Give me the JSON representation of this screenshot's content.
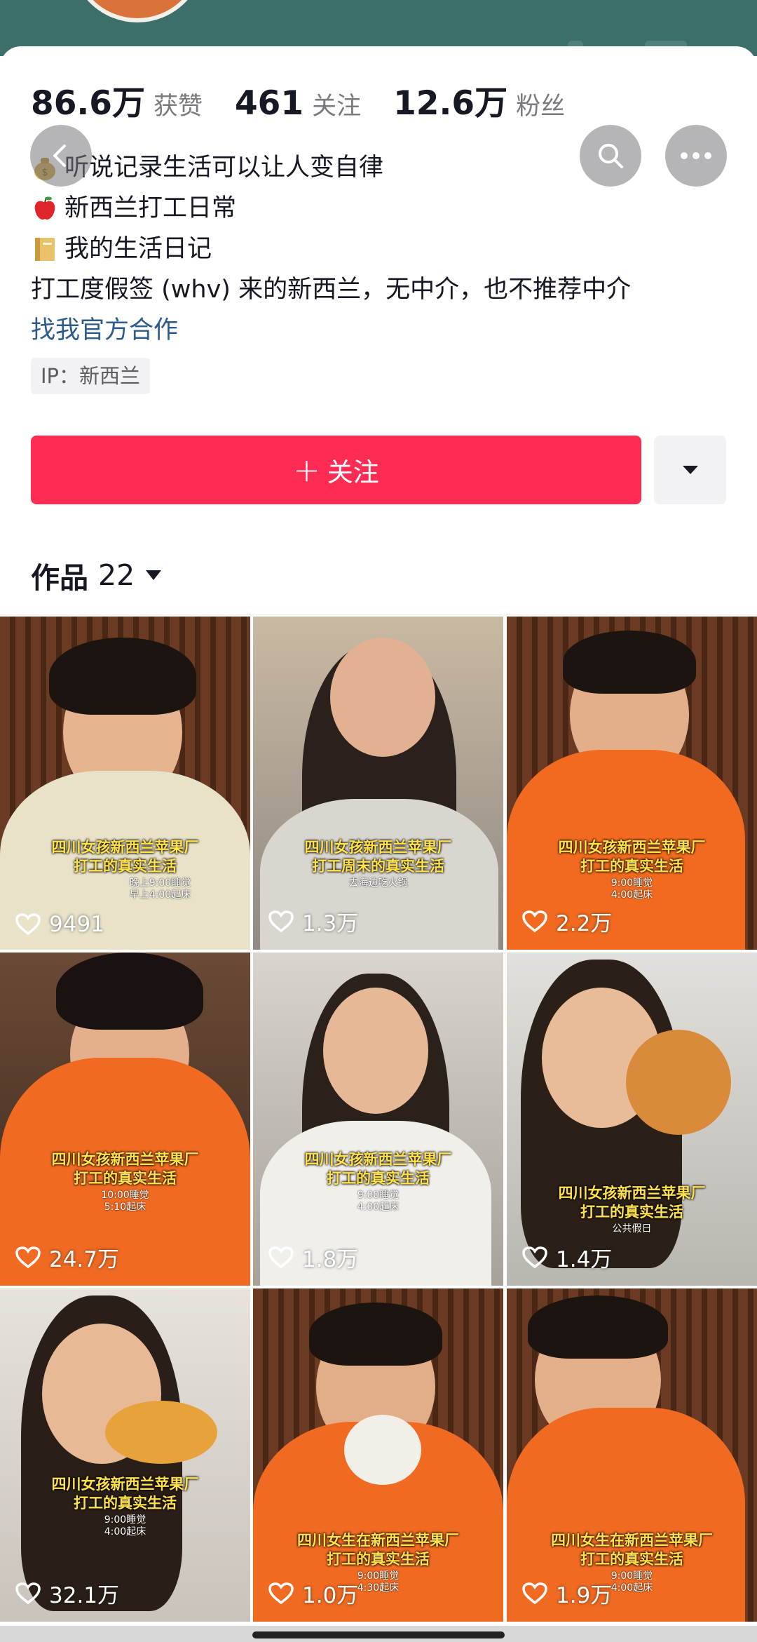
{
  "stats": [
    {
      "value": "86.6万",
      "label": "获赞"
    },
    {
      "value": "461",
      "label": "关注"
    },
    {
      "value": "12.6万",
      "label": "粉丝"
    }
  ],
  "bio": {
    "lines": [
      {
        "icon": "money-bag-emoji-icon",
        "text": "听说记录生活可以让人变自律"
      },
      {
        "icon": "red-apple-emoji-icon",
        "text": "新西兰打工日常"
      },
      {
        "icon": "notebook-emoji-icon",
        "text": "我的生活日记"
      },
      {
        "icon": "",
        "text": "打工度假签 (whv) 来的新西兰，无中介，也不推荐中介"
      }
    ],
    "link": "找我官方合作"
  },
  "ip_tag": "IP：新西兰",
  "follow_label": "关注",
  "works": {
    "label": "作品",
    "count": "22"
  },
  "videos": [
    {
      "likes": "9491",
      "caption1": "四川女孩新西兰苹果厂",
      "caption2": "打工的真实生活",
      "sub1": "晚上9:00睡觉",
      "sub2": "早上4:00起床"
    },
    {
      "likes": "1.3万",
      "caption1": "四川女孩新西兰苹果厂",
      "caption2": "打工周末的真实生活",
      "sub1": "去海边吃火锅",
      "sub2": ""
    },
    {
      "likes": "2.2万",
      "caption1": "四川女孩新西兰苹果厂",
      "caption2": "打工的真实生活",
      "sub1": "9:00睡觉",
      "sub2": "4:00起床"
    },
    {
      "likes": "24.7万",
      "caption1": "四川女孩新西兰苹果厂",
      "caption2": "打工的真实生活",
      "sub1": "10:00睡觉",
      "sub2": "5:10起床"
    },
    {
      "likes": "1.8万",
      "caption1": "四川女孩新西兰苹果厂",
      "caption2": "打工的真实生活",
      "sub1": "9:00睡觉",
      "sub2": "4:00起床"
    },
    {
      "likes": "1.4万",
      "caption1": "四川女孩新西兰苹果厂",
      "caption2": "打工的真实生活",
      "sub1": "公共假日",
      "sub2": ""
    },
    {
      "likes": "32.1万",
      "caption1": "四川女孩新西兰苹果厂",
      "caption2": "打工的真实生活",
      "sub1": "9:00睡觉",
      "sub2": "4:00起床"
    },
    {
      "likes": "1.0万",
      "caption1": "四川女生在新西兰苹果厂",
      "caption2": "打工的真实生活",
      "sub1": "9:00睡觉",
      "sub2": "4:30起床"
    },
    {
      "likes": "1.9万",
      "caption1": "四川女生在新西兰苹果厂",
      "caption2": "打工的真实生活",
      "sub1": "9:00睡觉",
      "sub2": "4:00起床"
    }
  ],
  "colors": {
    "follow": "#fe2c55",
    "link": "#2e5c8a",
    "topband": "#3d6f6a"
  }
}
